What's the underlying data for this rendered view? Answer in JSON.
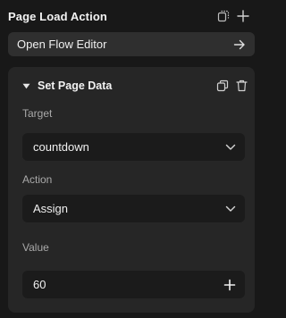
{
  "panel": {
    "title": "Page Load Action",
    "icons": [
      "duplicate-icon",
      "plus-icon"
    ]
  },
  "flow_editor": {
    "label": "Open Flow Editor",
    "icon": "arrow-right-icon"
  },
  "action_card": {
    "title": "Set Page Data",
    "collapse_icon": "caret-down-icon",
    "action_icons": [
      "copy-icon",
      "trash-icon"
    ],
    "target": {
      "label": "Target",
      "value": "countdown"
    },
    "action": {
      "label": "Action",
      "value": "Assign"
    },
    "value": {
      "label": "Value",
      "value": "60"
    }
  },
  "colors": {
    "background": "#181818",
    "button": "#2f2f2f",
    "card": "#262626",
    "field": "#1b1b1b",
    "label": "#a9a9a9",
    "text": "#f2f2f2"
  }
}
